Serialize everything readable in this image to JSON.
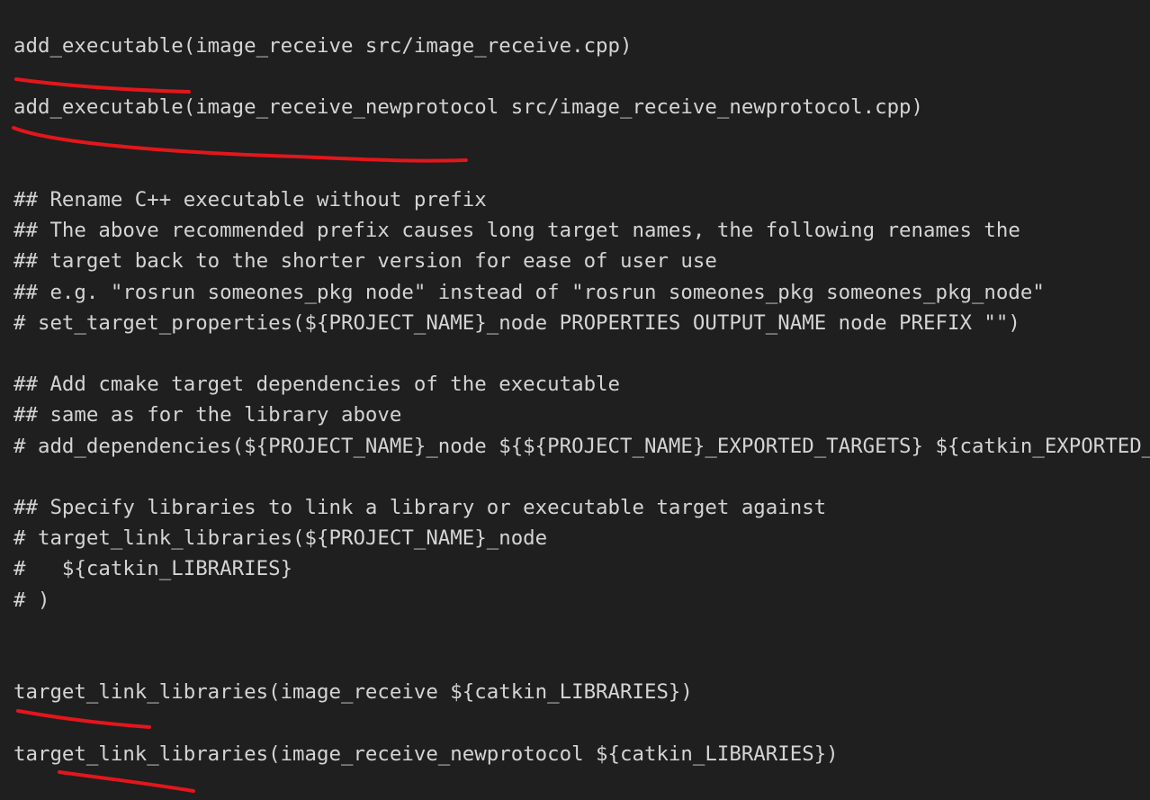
{
  "editor": {
    "lines": [
      "add_executable(image_receive src/image_receive.cpp)",
      "add_executable(image_receive_newprotocol src/image_receive_newprotocol.cpp)",
      "## Rename C++ executable without prefix",
      "## The above recommended prefix causes long target names, the following renames the",
      "## target back to the shorter version for ease of user use",
      "## e.g. \"rosrun someones_pkg node\" instead of \"rosrun someones_pkg someones_pkg_node\"",
      "# set_target_properties(${PROJECT_NAME}_node PROPERTIES OUTPUT_NAME node PREFIX \"\")",
      "## Add cmake target dependencies of the executable",
      "## same as for the library above",
      "# add_dependencies(${PROJECT_NAME}_node ${${PROJECT_NAME}_EXPORTED_TARGETS} ${catkin_EXPORTED_TARGETS})",
      "## Specify libraries to link a library or executable target against",
      "# target_link_libraries(${PROJECT_NAME}_node",
      "#   ${catkin_LIBRARIES}",
      "# )",
      "target_link_libraries(image_receive ${catkin_LIBRARIES})",
      "target_link_libraries(image_receive_newprotocol ${catkin_LIBRARIES})"
    ],
    "background": "#1f1f1f",
    "text_color": "#d4d4d4"
  },
  "annotations": {
    "color": "#e3161c",
    "kind": "red freehand underline"
  }
}
